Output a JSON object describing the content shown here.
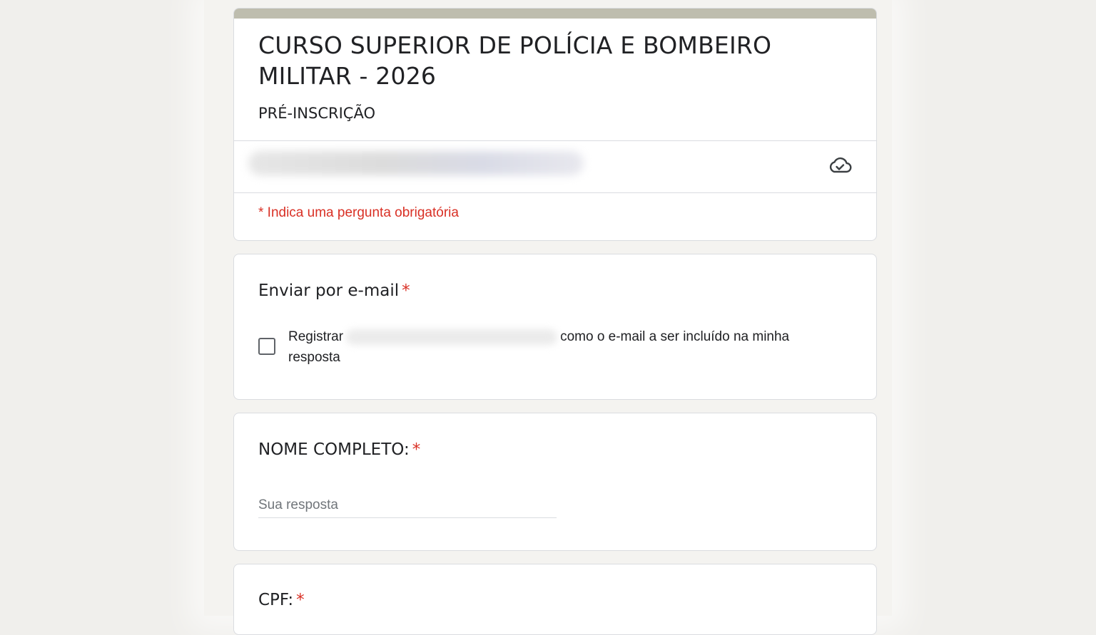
{
  "form": {
    "title": "CURSO SUPERIOR DE POLÍCIA E BOMBEIRO MILITAR - 2026",
    "subtitle": "PRÉ-INSCRIÇÃO",
    "required_note": "* Indica uma pergunta obrigatória",
    "accent_color": "#bebdae",
    "required_color": "#d93025"
  },
  "account": {
    "status_icon": "cloud-check-icon"
  },
  "questions": {
    "email": {
      "title": "Enviar por e-mail",
      "required_mark": "*",
      "checkbox_prefix": "Registrar",
      "checkbox_suffix": "como o e-mail a ser incluído na minha resposta",
      "checked": false
    },
    "nome": {
      "title": "NOME COMPLETO:",
      "required_mark": "*",
      "placeholder": "Sua resposta",
      "value": ""
    },
    "cpf": {
      "title": "CPF:",
      "required_mark": "*"
    }
  }
}
